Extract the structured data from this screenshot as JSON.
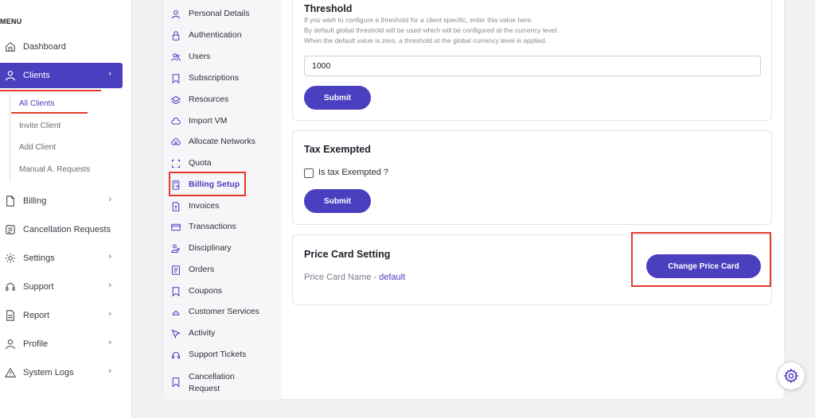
{
  "sidebar": {
    "menu_label": "MENU",
    "items": [
      {
        "label": "Dashboard",
        "icon": "home-icon",
        "chevron": ""
      },
      {
        "label": "Clients",
        "icon": "user-icon",
        "chevron": "›"
      },
      {
        "label": "Billing",
        "icon": "document-icon",
        "chevron": "›"
      },
      {
        "label": "Cancellation Requests",
        "icon": "receipt-icon",
        "chevron": ""
      },
      {
        "label": "Settings",
        "icon": "gear-icon",
        "chevron": "›"
      },
      {
        "label": "Support",
        "icon": "headset-icon",
        "chevron": "›"
      },
      {
        "label": "Report",
        "icon": "report-icon",
        "chevron": "›"
      },
      {
        "label": "Profile",
        "icon": "person-icon",
        "chevron": "›"
      },
      {
        "label": "System Logs",
        "icon": "warning-icon",
        "chevron": "›"
      }
    ],
    "client_subitems": [
      "All Clients",
      "Invite Client",
      "Add Client",
      "Manual A. Requests"
    ]
  },
  "client_nav": {
    "items": [
      {
        "label": "Personal Details",
        "icon": "person-icon"
      },
      {
        "label": "Authentication",
        "icon": "lock-icon"
      },
      {
        "label": "Users",
        "icon": "users-icon"
      },
      {
        "label": "Subscriptions",
        "icon": "bookmark-icon"
      },
      {
        "label": "Resources",
        "icon": "layers-icon"
      },
      {
        "label": "Import VM",
        "icon": "cloud-icon"
      },
      {
        "label": "Allocate Networks",
        "icon": "network-icon"
      },
      {
        "label": "Quota",
        "icon": "frame-icon"
      },
      {
        "label": "Billing Setup",
        "icon": "calculator-icon"
      },
      {
        "label": "Invoices",
        "icon": "invoice-icon"
      },
      {
        "label": "Transactions",
        "icon": "card-icon"
      },
      {
        "label": "Disciplinary",
        "icon": "people-icon"
      },
      {
        "label": "Orders",
        "icon": "orders-icon"
      },
      {
        "label": "Coupons",
        "icon": "bookmark-icon"
      },
      {
        "label": "Customer Services",
        "icon": "service-icon"
      },
      {
        "label": "Activity",
        "icon": "cursor-icon"
      },
      {
        "label": "Support Tickets",
        "icon": "headset-icon"
      },
      {
        "label": "Cancellation",
        "label2": "Request",
        "icon": "bookmark-icon"
      }
    ]
  },
  "threshold": {
    "title": "Threshold",
    "help1": "If you wish to configure a threshold for a client specific, enter this value here.",
    "help2": "By default global threshold will be used which will be configured at the currency level.",
    "help3": "When the default value is zero, a threshold at the global currency level is applied.",
    "value": "1000",
    "submit": "Submit"
  },
  "tax": {
    "title": "Tax Exempted",
    "checkbox_label": "Is tax Exempted ?",
    "checked": false,
    "submit": "Submit"
  },
  "price_card": {
    "title": "Price Card Setting",
    "name_label": "Price Card Name - ",
    "name_value": "default",
    "button": "Change Price Card"
  },
  "colors": {
    "accent": "#4a3fbf",
    "highlight_border": "#e53b2c"
  }
}
